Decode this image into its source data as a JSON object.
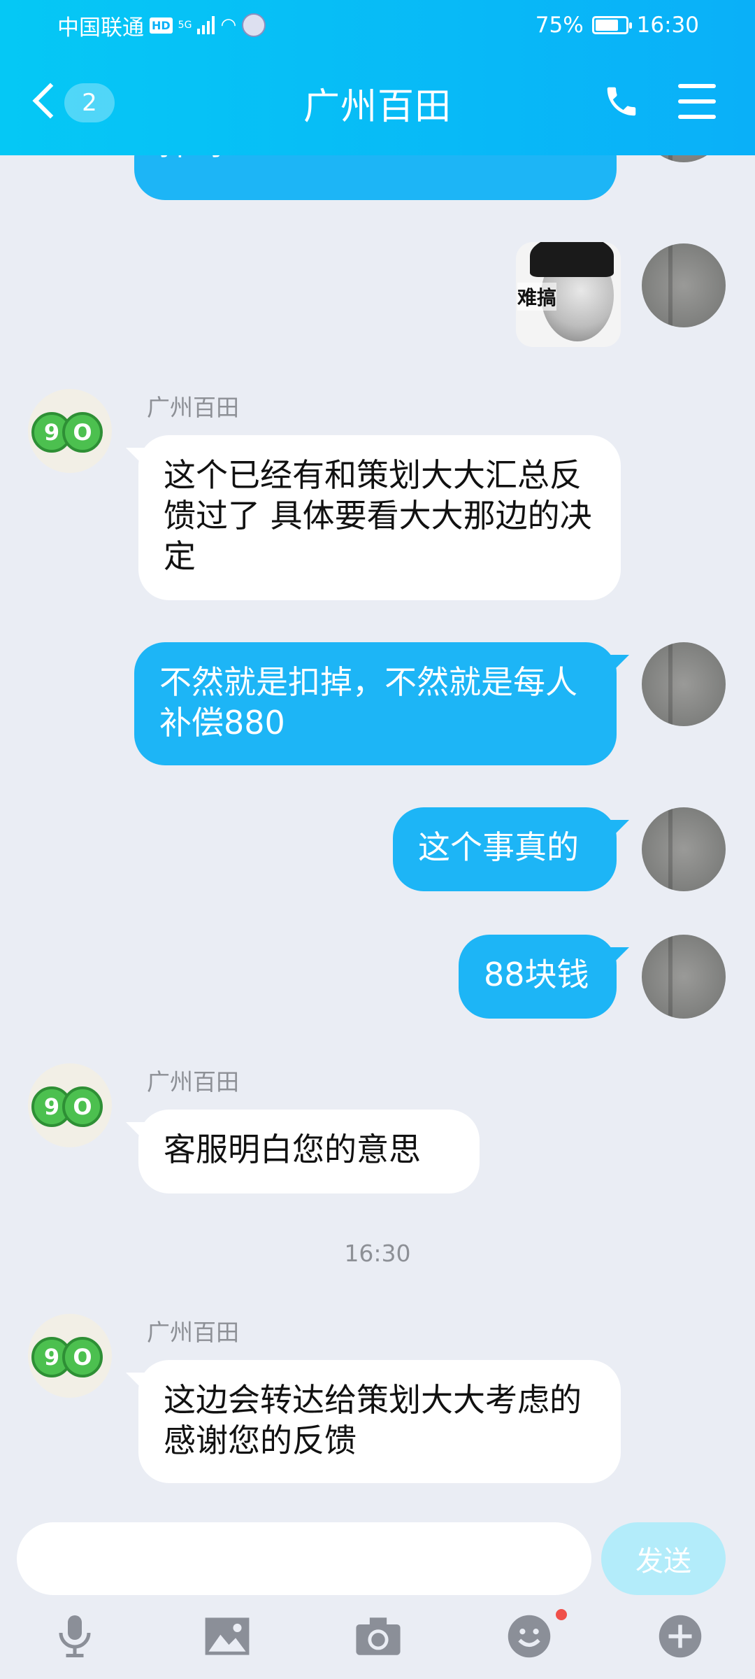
{
  "status_bar": {
    "carrier": "中国联通",
    "hd": "HD",
    "network": "5G",
    "battery": "75%",
    "time": "16:30"
  },
  "header": {
    "back_badge": "2",
    "title": "广州百田",
    "icons": [
      "back-icon",
      "phone-icon",
      "menu-icon"
    ]
  },
  "messages": [
    {
      "side": "out",
      "text": "掉吗"
    },
    {
      "side": "out",
      "type": "sticker",
      "sticker_text": "难搞"
    },
    {
      "side": "in",
      "sender": "广州百田",
      "text": "这个已经有和策划大大汇总反馈过了 具体要看大大那边的决定"
    },
    {
      "side": "out",
      "text": "不然就是扣掉，不然就是每人补偿880"
    },
    {
      "side": "out",
      "text": "这个事真的"
    },
    {
      "side": "out",
      "text": "88块钱"
    },
    {
      "side": "in",
      "sender": "广州百田",
      "text": "客服明白您的意思"
    },
    {
      "type": "timestamp",
      "text": "16:30"
    },
    {
      "side": "in",
      "sender": "广州百田",
      "text": "这边会转达给策划大大考虑的 感谢您的反馈"
    }
  ],
  "input_bar": {
    "placeholder": "",
    "send_label": "发送",
    "tools": [
      "microphone-icon",
      "image-icon",
      "camera-icon",
      "emoji-icon",
      "plus-icon"
    ]
  },
  "colors": {
    "header_start": "#05c8f5",
    "header_end": "#0ab0f8",
    "bubble_out": "#1db5f6",
    "bubble_in": "#ffffff",
    "background": "#eaedf4",
    "send_disabled": "#b3ecfa",
    "notify_dot": "#f0504a"
  }
}
